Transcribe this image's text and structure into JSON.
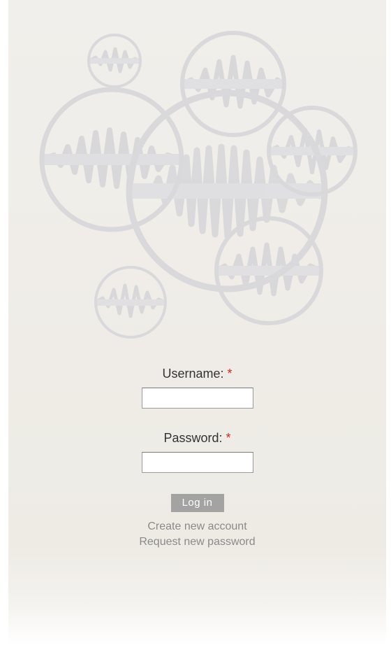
{
  "login_form": {
    "username_label": "Username:",
    "password_label": "Password:",
    "required_marker": "*",
    "username_value": "",
    "password_value": "",
    "submit_label": "Log in",
    "links": {
      "create_account": "Create new account",
      "request_password": "Request new password"
    }
  },
  "colors": {
    "panel_background": "#f1efeb",
    "required_marker": "#d9251d",
    "button_background": "#a3a3a3",
    "link_text": "#8a8a8a",
    "circle_stroke": "#d6d6d8"
  },
  "icons": {
    "header_art": "sound-wave-circles-logo"
  }
}
